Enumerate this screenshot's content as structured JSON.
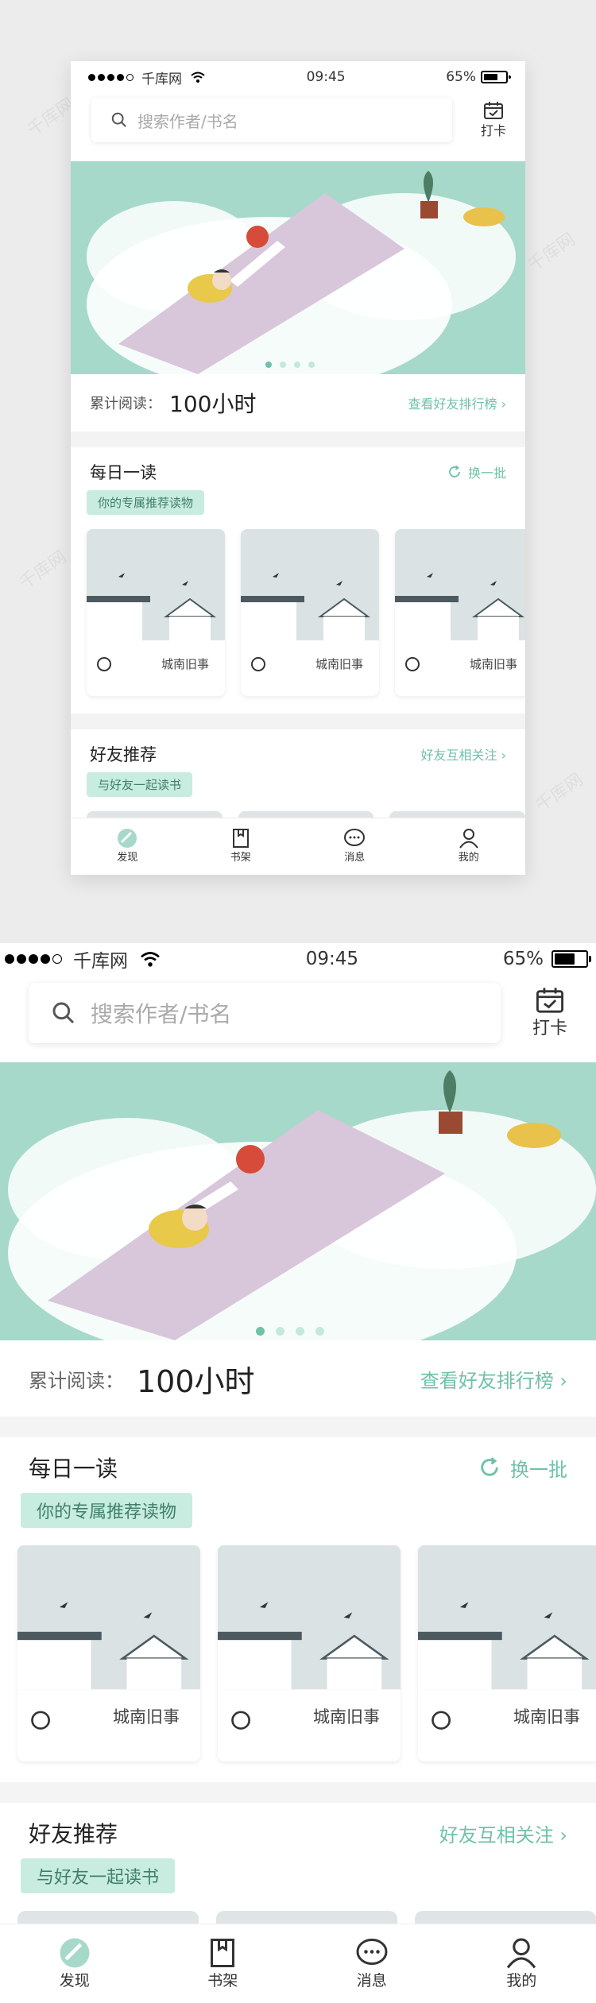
{
  "status": {
    "carrier": "千库网",
    "time": "09:45",
    "battery": "65%"
  },
  "search": {
    "placeholder": "搜索作者/书名"
  },
  "checkin": {
    "label": "打卡"
  },
  "banner": {
    "active_dot": 0,
    "dot_count": 4
  },
  "reading": {
    "label": "累计阅读：",
    "value": "100小时",
    "rank_link": "查看好友排行榜 ›"
  },
  "daily": {
    "title": "每日一读",
    "refresh": "换一批",
    "tag": "你的专属推荐读物"
  },
  "books": [
    {
      "title": "城南旧事"
    },
    {
      "title": "城南旧事"
    },
    {
      "title": "城南旧事"
    }
  ],
  "friends": {
    "title": "好友推荐",
    "follow": "好友互相关注 ›",
    "tag": "与好友一起读书"
  },
  "nav": [
    {
      "label": "发现",
      "icon": "discover-icon"
    },
    {
      "label": "书架",
      "icon": "bookshelf-icon"
    },
    {
      "label": "消息",
      "icon": "message-icon"
    },
    {
      "label": "我的",
      "icon": "profile-icon"
    }
  ],
  "colors": {
    "accent": "#6fc2a8",
    "banner": "#a6d9ca",
    "tag_bg": "#c8ece0"
  }
}
